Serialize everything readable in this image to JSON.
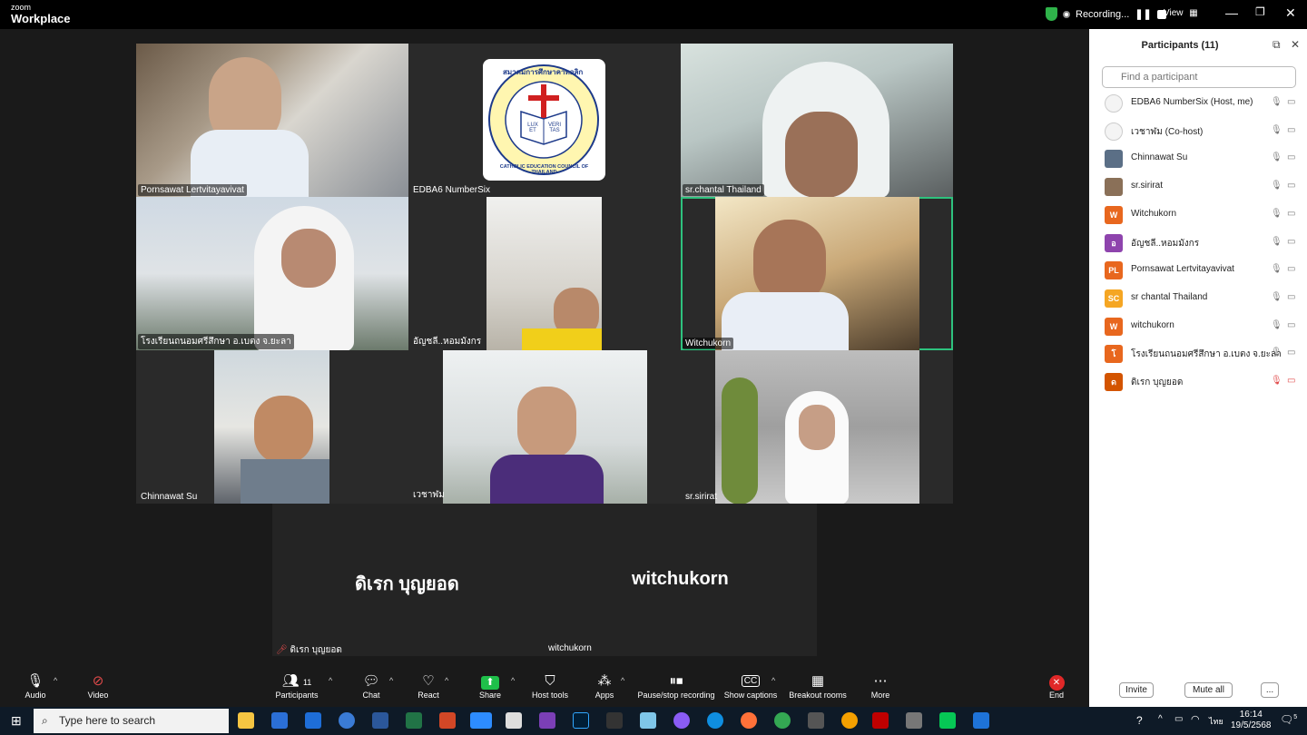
{
  "titlebar": {
    "brand_small": "zoom",
    "brand_big": "Workplace",
    "recording_label": "Recording...",
    "view_label": "View"
  },
  "tiles": [
    {
      "name": "Pornsawat Lertvitayavivat"
    },
    {
      "name": "EDBA6 NumberSix"
    },
    {
      "name": "sr.chantal Thailand"
    },
    {
      "name": "โรงเรียนถนอมศรีสึกษา อ.เบตง จ.ยะลา"
    },
    {
      "name": "อัญชลี..หอมมังกร"
    },
    {
      "name": "Witchukorn"
    },
    {
      "name": "Chinnawat Su"
    },
    {
      "name": "เวชาฬม"
    },
    {
      "name": "sr.sirirat"
    }
  ],
  "logo": {
    "top_text": "สมาคมการศึกษาคาทอลิก",
    "ring_text": "CATHOLIC EDUCATION COUNCIL OF THAILAND",
    "book_left": "LUX ET",
    "book_right": "VERI TAS"
  },
  "audio_only": [
    {
      "big_name": "ดิเรก บุญยอด",
      "label": "ดิเรก บุญยอด"
    },
    {
      "big_name": "witchukorn",
      "label": "witchukorn"
    }
  ],
  "participants_panel": {
    "title": "Participants (11)",
    "search_placeholder": "Find a participant",
    "invite_label": "Invite",
    "mute_all_label": "Mute all",
    "more_label": "...",
    "list": [
      {
        "initials": "",
        "name": "EDBA6 NumberSix (Host, me)",
        "color": "#f4f4f4"
      },
      {
        "initials": "",
        "name": "เวชาฬม (Co-host)",
        "color": "#f4f4f4"
      },
      {
        "initials": "",
        "name": "Chinnawat Su",
        "color": "#5b6f86"
      },
      {
        "initials": "",
        "name": "sr.sirirat",
        "color": "#8a7058"
      },
      {
        "initials": "W",
        "name": "Witchukorn",
        "color": "#e8671e"
      },
      {
        "initials": "อ",
        "name": "อัญชลี..หอมมังกร",
        "color": "#8e44ad"
      },
      {
        "initials": "PL",
        "name": "Pornsawat Lertvitayavivat",
        "color": "#e8671e"
      },
      {
        "initials": "SC",
        "name": "sr chantal Thailand",
        "color": "#f5a623"
      },
      {
        "initials": "W",
        "name": "witchukorn",
        "color": "#e8671e"
      },
      {
        "initials": "โ",
        "name": "โรงเรียนถนอมศรีสึกษา อ.เบตง จ.ยะลา",
        "color": "#e8671e"
      },
      {
        "initials": "ด",
        "name": "ดิเรก บุญยอด",
        "color": "#d35400"
      }
    ]
  },
  "toolbar": {
    "audio": "Audio",
    "video": "Video",
    "participants": "Participants",
    "participants_count": "11",
    "chat": "Chat",
    "react": "React",
    "share": "Share",
    "host_tools": "Host tools",
    "apps": "Apps",
    "pause_recording": "Pause/stop recording",
    "captions": "Show captions",
    "breakout": "Breakout rooms",
    "more": "More",
    "end": "End"
  },
  "taskbar": {
    "search_text": "Type here to search",
    "lang": "ไทย",
    "time": "16:14",
    "date": "19/5/2568",
    "notif_count": "5"
  },
  "colors": {
    "active_speaker": "#2ec27e",
    "share_green": "#1fbf4a",
    "end_red": "#e02828"
  }
}
